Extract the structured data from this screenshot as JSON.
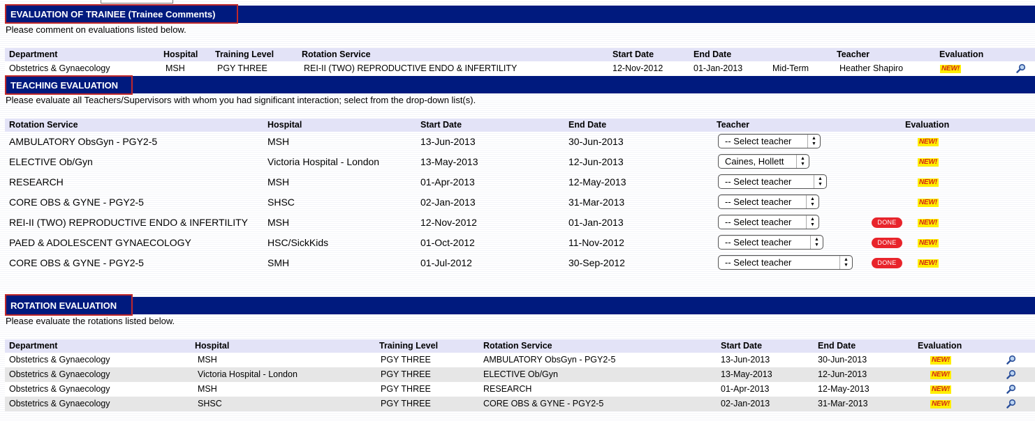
{
  "colors": {
    "section_bar": "#001a7e",
    "title_border": "#c0282a",
    "header_row": "#e3e3f7",
    "new_badge_bg": "#ffee00",
    "new_badge_text": "#d32a16",
    "done_badge": "#e8242b"
  },
  "badges": {
    "new": "NEW!",
    "done": "DONE"
  },
  "trainee": {
    "title": "EVALUATION OF TRAINEE (Trainee Comments)",
    "instructions": "Please comment on evaluations listed below.",
    "headers": {
      "department": "Department",
      "hospital": "Hospital",
      "training_level": "Training Level",
      "rotation_service": "Rotation Service",
      "start_date": "Start Date",
      "end_date": "End Date",
      "teacher": "Teacher",
      "evaluation": "Evaluation"
    },
    "row": {
      "department": "Obstetrics & Gynaecology",
      "hospital": "MSH",
      "training_level": "PGY THREE",
      "rotation_service": "REI-II (TWO) REPRODUCTIVE ENDO & INFERTILITY",
      "start_date": "12-Nov-2012",
      "end_date": "01-Jan-2013",
      "term": "Mid-Term",
      "teacher": "Heather Shapiro",
      "icon": "magnifier-icon"
    }
  },
  "teaching": {
    "title": "TEACHING EVALUATION",
    "instructions": "Please evaluate all Teachers/Supervisors with whom you had significant interaction; select from the drop-down list(s).",
    "headers": {
      "rotation_service": "Rotation Service",
      "hospital": "Hospital",
      "start_date": "Start Date",
      "end_date": "End Date",
      "teacher": "Teacher",
      "evaluation": "Evaluation"
    },
    "rows": [
      {
        "rotation_service": "AMBULATORY ObsGyn - PGY2-5",
        "hospital": "MSH",
        "start_date": "13-Jun-2013",
        "end_date": "30-Jun-2013",
        "teacher": "-- Select teacher",
        "done": false
      },
      {
        "rotation_service": "ELECTIVE Ob/Gyn",
        "hospital": "Victoria Hospital - London",
        "start_date": "13-May-2013",
        "end_date": "12-Jun-2013",
        "teacher": "Caines, Hollett",
        "done": false
      },
      {
        "rotation_service": "RESEARCH",
        "hospital": "MSH",
        "start_date": "01-Apr-2013",
        "end_date": "12-May-2013",
        "teacher": "-- Select teacher",
        "done": false
      },
      {
        "rotation_service": "CORE OBS & GYNE - PGY2-5",
        "hospital": "SHSC",
        "start_date": "02-Jan-2013",
        "end_date": "31-Mar-2013",
        "teacher": "-- Select teacher",
        "done": false
      },
      {
        "rotation_service": "REI-II (TWO) REPRODUCTIVE ENDO & INFERTILITY",
        "hospital": "MSH",
        "start_date": "12-Nov-2012",
        "end_date": "01-Jan-2013",
        "teacher": "-- Select teacher",
        "done": true
      },
      {
        "rotation_service": "PAED & ADOLESCENT GYNAECOLOGY",
        "hospital": "HSC/SickKids",
        "start_date": "01-Oct-2012",
        "end_date": "11-Nov-2012",
        "teacher": "-- Select teacher",
        "done": true
      },
      {
        "rotation_service": "CORE OBS & GYNE - PGY2-5",
        "hospital": "SMH",
        "start_date": "01-Jul-2012",
        "end_date": "30-Sep-2012",
        "teacher": "-- Select teacher",
        "done": true
      }
    ]
  },
  "rotation": {
    "title": "ROTATION EVALUATION",
    "instructions": "Please evaluate the rotations listed below.",
    "headers": {
      "department": "Department",
      "hospital": "Hospital",
      "training_level": "Training Level",
      "rotation_service": "Rotation Service",
      "start_date": "Start Date",
      "end_date": "End Date",
      "evaluation": "Evaluation"
    },
    "rows": [
      {
        "department": "Obstetrics & Gynaecology",
        "hospital": "MSH",
        "training_level": "PGY THREE",
        "rotation_service": "AMBULATORY ObsGyn - PGY2-5",
        "start_date": "13-Jun-2013",
        "end_date": "30-Jun-2013"
      },
      {
        "department": "Obstetrics & Gynaecology",
        "hospital": "Victoria Hospital - London",
        "training_level": "PGY THREE",
        "rotation_service": "ELECTIVE Ob/Gyn",
        "start_date": "13-May-2013",
        "end_date": "12-Jun-2013"
      },
      {
        "department": "Obstetrics & Gynaecology",
        "hospital": "MSH",
        "training_level": "PGY THREE",
        "rotation_service": "RESEARCH",
        "start_date": "01-Apr-2013",
        "end_date": "12-May-2013"
      },
      {
        "department": "Obstetrics & Gynaecology",
        "hospital": "SHSC",
        "training_level": "PGY THREE",
        "rotation_service": "CORE OBS & GYNE - PGY2-5",
        "start_date": "02-Jan-2013",
        "end_date": "31-Mar-2013"
      }
    ]
  }
}
